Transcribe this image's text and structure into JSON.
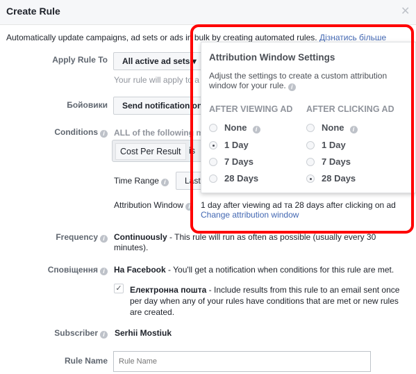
{
  "dialog": {
    "title": "Create Rule",
    "close_icon": "close-icon"
  },
  "intro": {
    "text": "Automatically update campaigns, ad sets or ads in bulk by creating automated rules.",
    "link": "Дізнатись більше"
  },
  "apply_rule": {
    "label": "Apply Rule To",
    "value": "All active ad sets",
    "helper": "Your rule will apply to a"
  },
  "action": {
    "label": "Бойовики",
    "value": "Send notification on"
  },
  "conditions": {
    "label": "Conditions",
    "text": "ALL of the following m",
    "metric": "Cost Per Result",
    "operator": "is"
  },
  "time_range": {
    "label": "Time Range",
    "value": "Last"
  },
  "attribution": {
    "label": "Attribution Window",
    "text": "1 day after viewing ad та 28 days after clicking on ad",
    "link": "Change attribution window"
  },
  "frequency": {
    "label": "Frequency",
    "bold": "Continuously",
    "text": " - This rule will run as often as possible (usually every 30 minutes)."
  },
  "notifications": {
    "label": "Сповіщення",
    "bold": "На Facebook",
    "text": " - You'll get a notification when conditions for this rule are met.",
    "email_checked": true,
    "email_bold": "Електронна пошта",
    "email_text": " - Include results from this rule to an email sent once per day when any of your rules have conditions that are met or new rules are created."
  },
  "subscriber": {
    "label": "Subscriber",
    "value": "Serhii Mostiuk"
  },
  "rule_name": {
    "label": "Rule Name",
    "placeholder": "Rule Name",
    "value": ""
  },
  "popover": {
    "title": "Attribution Window Settings",
    "desc": "Adjust the settings to create a custom attribution window for your rule.",
    "view": {
      "header": "AFTER VIEWING AD",
      "options": [
        "None",
        "1 Day",
        "7 Days",
        "28 Days"
      ],
      "selected": "1 Day"
    },
    "click": {
      "header": "AFTER CLICKING AD",
      "options": [
        "None",
        "1 Day",
        "7 Days",
        "28 Days"
      ],
      "selected": "28 Days"
    }
  },
  "highlight_color": "#ff0000"
}
